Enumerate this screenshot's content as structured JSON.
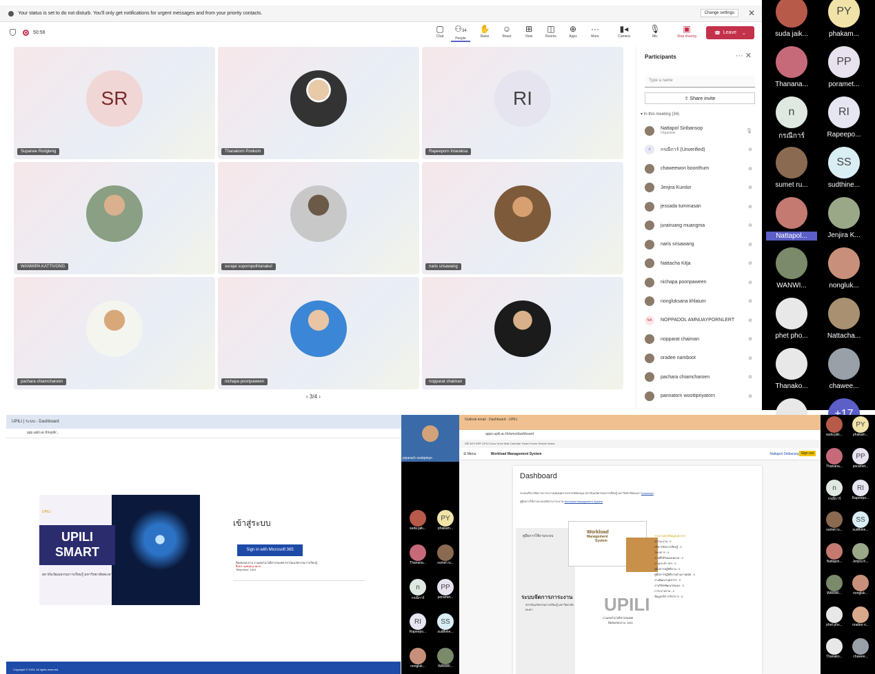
{
  "teams": {
    "notification": "Your status is set to do not disturb. You'll only get notifications for urgent messages and from your priority contacts.",
    "change_settings": "Change settings",
    "timer": "50:56",
    "toolbar": [
      {
        "icon": "chat-icon",
        "label": "Chat"
      },
      {
        "icon": "people-icon",
        "label": "People",
        "count": "34"
      },
      {
        "icon": "raise-hand-icon",
        "label": "Raise"
      },
      {
        "icon": "react-icon",
        "label": "React"
      },
      {
        "icon": "view-icon",
        "label": "View"
      },
      {
        "icon": "rooms-icon",
        "label": "Rooms"
      },
      {
        "icon": "apps-icon",
        "label": "Apps"
      },
      {
        "icon": "more-icon",
        "label": "More"
      },
      {
        "icon": "camera-icon",
        "label": "Camera"
      },
      {
        "icon": "mic-icon",
        "label": "Mic"
      },
      {
        "icon": "stop-sharing-icon",
        "label": "Stop sharing"
      }
    ],
    "leave_label": "Leave",
    "tiles": [
      {
        "initials": "SR",
        "name": "Supanee Rodgleng"
      },
      {
        "initials": "",
        "name": "Thanakorn Pookom"
      },
      {
        "initials": "RI",
        "name": "Rapeeporn Intaraksa"
      },
      {
        "initials": "",
        "name": "WANWIPA KATTIVONG"
      },
      {
        "initials": "",
        "name": "surajai supornputhtanakul"
      },
      {
        "initials": "",
        "name": "naris srisawang"
      },
      {
        "initials": "",
        "name": "pachara chiamcharoen"
      },
      {
        "initials": "",
        "name": "nichapa poonpaween"
      },
      {
        "initials": "",
        "name": "nopparat chaiman"
      }
    ],
    "pager": "3/4",
    "participants": {
      "title": "Participants",
      "search_placeholder": "Type a name",
      "share_label": "Share invite",
      "section": "In this meeting (34)",
      "list": [
        {
          "name": "Nattapol Siribansop",
          "sub": "Organizer",
          "avatar": ""
        },
        {
          "name": "กรณีการ์ (Unverified)",
          "sub": "",
          "avatar": "n"
        },
        {
          "name": "chaweewon boonthum",
          "sub": "",
          "avatar": ""
        },
        {
          "name": "Jenjira Kumlor",
          "sub": "",
          "avatar": ""
        },
        {
          "name": "jessada tummasan",
          "sub": "",
          "avatar": ""
        },
        {
          "name": "jurairuang muangma",
          "sub": "",
          "avatar": ""
        },
        {
          "name": "naris srisawang",
          "sub": "",
          "avatar": ""
        },
        {
          "name": "Nattacha Kitja",
          "sub": "",
          "avatar": ""
        },
        {
          "name": "nichapa poonpaween",
          "sub": "",
          "avatar": ""
        },
        {
          "name": "nongluksana khlaium",
          "sub": "",
          "avatar": ""
        },
        {
          "name": "NOPPADOL AMNUAYPORNLERT",
          "sub": "",
          "avatar": "NA"
        },
        {
          "name": "nopparat chaiman",
          "sub": "",
          "avatar": ""
        },
        {
          "name": "oradee namboot",
          "sub": "",
          "avatar": ""
        },
        {
          "name": "pachara chiamcharoen",
          "sub": "",
          "avatar": ""
        },
        {
          "name": "pannatorn woottipriyatorn",
          "sub": "",
          "avatar": ""
        }
      ]
    }
  },
  "gallery": [
    {
      "label": "suda jaik...",
      "initials": "",
      "color": "#b85a4a"
    },
    {
      "label": "phakam...",
      "initials": "PY",
      "color": "#f1e2a8"
    },
    {
      "label": "Thanana...",
      "initials": "",
      "color": "#c66a7a"
    },
    {
      "label": "poramet...",
      "initials": "PP",
      "color": "#e7e2ee"
    },
    {
      "label": "กรณีการ์",
      "initials": "n",
      "color": "#dfe9e2"
    },
    {
      "label": "Rapeepo...",
      "initials": "RI",
      "color": "#e6e6f3"
    },
    {
      "label": "sumet ru...",
      "initials": "",
      "color": "#8a6a50"
    },
    {
      "label": "sudthine...",
      "initials": "SS",
      "color": "#d9eef4"
    },
    {
      "label": "Nattapol...",
      "initials": "",
      "color": "#c47a70"
    },
    {
      "label": "Jenjira K...",
      "initials": "",
      "color": "#9aa888"
    },
    {
      "label": "WANWI...",
      "initials": "",
      "color": "#7a8a6a"
    },
    {
      "label": "nongluk...",
      "initials": "",
      "color": "#c8907a"
    },
    {
      "label": "phet pho...",
      "initials": "",
      "color": "#e8e8e8"
    },
    {
      "label": "Nattacha...",
      "initials": "",
      "color": "#a89070"
    },
    {
      "label": "Thanako...",
      "initials": "",
      "color": "#e8e8e8"
    },
    {
      "label": "chawee...",
      "initials": "",
      "color": "#9aa0a8"
    },
    {
      "label": "",
      "initials": "",
      "color": "#e8e8e8"
    },
    {
      "label": "",
      "initials": "+17",
      "color": "#5b5fc7"
    }
  ],
  "left_share": {
    "tab": "UPILI | ระบบ - Dashboard",
    "url": "app.upili.ac.th/upili/...",
    "brand_line1": "UPILI",
    "brand_line2": "SMART",
    "brand_caption": "สถาบันวัฒนธรรมการเรียนรู้ มหาวิทยาลัยพะเยา",
    "brand_top": "UPILI",
    "login_title": "เข้าสู่ระบบ",
    "login_button": "Sign in with Microsoft 365",
    "info1": "ติดต่อสอบถาม งานเทคโนโลยีสารสนเทศ สถาบันนวัตกรรมการเรียนรู้",
    "info2": "อีเมล: upili@up.ac.th",
    "info3": "Telephone: 1641",
    "footer": "Copyright © 2023. All rights reserved.",
    "presenter": "piyarach sookpinyo"
  },
  "left_strip": [
    {
      "label": "suda jaik...",
      "initials": "",
      "color": "#b85a4a"
    },
    {
      "label": "phakam...",
      "initials": "PY",
      "color": "#f1e2a8"
    },
    {
      "label": "Thanana...",
      "initials": "",
      "color": "#c66a7a"
    },
    {
      "label": "sumet ru...",
      "initials": "",
      "color": "#8a6a50"
    },
    {
      "label": "กรณีการ์",
      "initials": "n",
      "color": "#dfe9e2"
    },
    {
      "label": "poramet...",
      "initials": "PP",
      "color": "#e7e2ee"
    },
    {
      "label": "Rapeepo...",
      "initials": "RI",
      "color": "#e6e6f3"
    },
    {
      "label": "sudthine...",
      "initials": "SS",
      "color": "#d9eef4"
    },
    {
      "label": "nongluk...",
      "initials": "",
      "color": "#c8907a"
    },
    {
      "label": "WANWI...",
      "initials": "",
      "color": "#7a8a6a"
    }
  ],
  "right_share": {
    "tab1": "Outlook email",
    "tab2": "Dashboard",
    "tab3": "UPILI",
    "url": "apps.upili.ac.th/wms/dashboard",
    "bookmarks": "หน้าแรก ERP UPILI Docs Drive Mail Calendar Tasks Forms Sheets Notes",
    "menu": "Menu",
    "app_title": "Workload Management System",
    "user": "Nattapol Siribansop",
    "signout": "Sign out",
    "title": "Dashboard",
    "line1": "ระบบบริหารจัดการภาระงานของบุคลากรสายสนับสนุน สถาบันนวัตกรรมการเรียนรู้ มหาวิทยาลัยพะเยา",
    "link1": "Download",
    "line2": "คู่มือการใช้งานระบบบริหารภาระงาน",
    "link2": "Workload Management System",
    "manual": "คู่มือการใช้งานระบบ",
    "system_title": "ระบบจัดการภาระงาน",
    "system_sub": "สถาบันนวัตกรรมการเรียนรู้ มหาวิทยาลัยพะเยา",
    "wl1": "Workload",
    "wl2": "Management",
    "wl3": "System",
    "upili": "UPILI",
    "contact1": "งานเทคโนโลยีสารสนเทศ",
    "contact2": "ติดต่อสอบถาม: 1641",
    "stats_header": "รายงานสรุปข้อมูลบุคลากร",
    "stats": [
      "สถานะงาน : 0",
      "บริหารจัดการเรียนรู้ : 0",
      "โครงการ : 0",
      "งานที่ได้รับมอบหมาย : 0",
      "งานประจำ KPI : 0",
      "คู่มือการปฏิบัติงาน : 0",
      "คู่มือการปฏิบัติงานส่วนงานย่อย : 0",
      "งานพัฒนาบุคลากร : 0",
      "งานวิจัย/พัฒนาตนเอง : 0",
      "ภาระงานรวม : 4",
      "ข้อมูลบริการวิชาการ : 0"
    ]
  },
  "right_strip": [
    {
      "label": "suda jaik...",
      "initials": "",
      "color": "#b85a4a"
    },
    {
      "label": "phakam...",
      "initials": "PY",
      "color": "#f1e2a8"
    },
    {
      "label": "Thanana...",
      "initials": "",
      "color": "#c66a7a"
    },
    {
      "label": "poramet...",
      "initials": "PP",
      "color": "#e7e2ee"
    },
    {
      "label": "กรณีการ์",
      "initials": "n",
      "color": "#dfe9e2"
    },
    {
      "label": "Rapeepo...",
      "initials": "RI",
      "color": "#e6e6f3"
    },
    {
      "label": "sumet ru...",
      "initials": "",
      "color": "#8a6a50"
    },
    {
      "label": "sudthine...",
      "initials": "SS",
      "color": "#d9eef4"
    },
    {
      "label": "Nattapol...",
      "initials": "",
      "color": "#c47a70"
    },
    {
      "label": "Jenjira K...",
      "initials": "",
      "color": "#9aa888"
    },
    {
      "label": "WANWI...",
      "initials": "",
      "color": "#7a8a6a"
    },
    {
      "label": "nongluk...",
      "initials": "",
      "color": "#c8907a"
    },
    {
      "label": "phet pho...",
      "initials": "",
      "color": "#e8e8e8"
    },
    {
      "label": "oradee n...",
      "initials": "",
      "color": "#d7a98a"
    },
    {
      "label": "Thanako...",
      "initials": "",
      "color": "#e8e8e8"
    },
    {
      "label": "chawee...",
      "initials": "",
      "color": "#9aa0a8"
    }
  ]
}
